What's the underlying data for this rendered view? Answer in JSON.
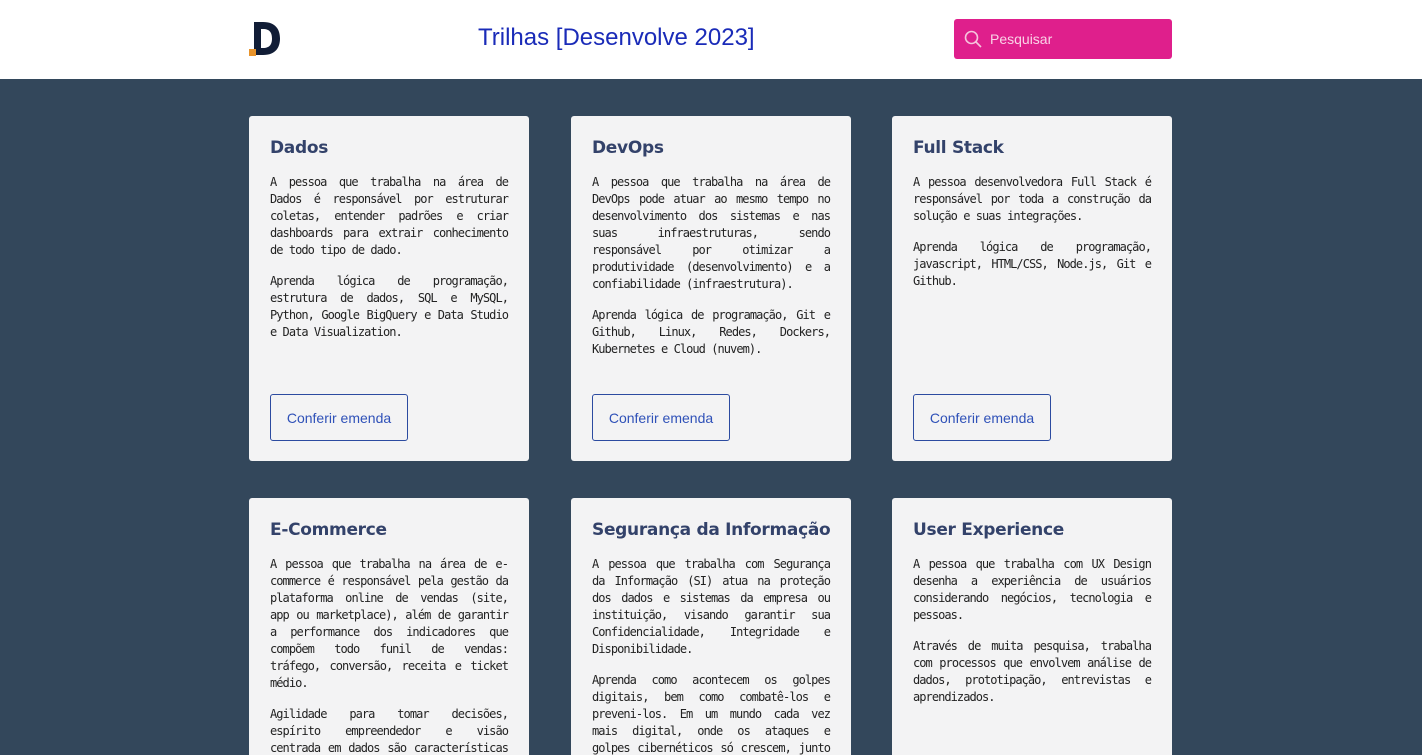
{
  "header": {
    "title": "Trilhas [Desenvolve 2023]",
    "logo_letter": "D",
    "search_placeholder": "Pesquisar"
  },
  "colors": {
    "background": "#33475b",
    "header": "#ffffff",
    "title": "#1a2bb8",
    "search": "#df1f8c",
    "card": "#f3f3f4",
    "card_title": "#33426a",
    "button": "#2c4ba0",
    "logo_accent": "#e8942c"
  },
  "cards": [
    {
      "title": "Dados",
      "paragraphs": [
        "A pessoa que trabalha na área de Dados é responsável por estruturar coletas, entender padrões e criar dashboards para extrair conhecimento de todo tipo de dado.",
        "Aprenda lógica de programação, estrutura de dados, SQL e MySQL, Python, Google BigQuery e Data Studio e Data Visualization."
      ],
      "button": "Conferir emenda"
    },
    {
      "title": "DevOps",
      "paragraphs": [
        "A pessoa que trabalha na área de DevOps pode atuar ao mesmo tempo no desenvolvimento dos sistemas e nas suas infraestruturas, sendo responsável por otimizar a produtividade (desenvolvimento) e a confiabilidade (infraestrutura).",
        "Aprenda lógica de programação, Git e Github, Linux, Redes, Dockers, Kubernetes e Cloud (nuvem)."
      ],
      "button": "Conferir emenda"
    },
    {
      "title": "Full Stack",
      "paragraphs": [
        "A pessoa desenvolvedora Full Stack é responsável por toda a construção da solução e suas integrações.",
        "Aprenda lógica de programação, javascript, HTML/CSS, Node.js, Git e Github."
      ],
      "button": "Conferir emenda"
    },
    {
      "title": "E-Commerce",
      "paragraphs": [
        "A pessoa que trabalha na área de e-commerce é responsável pela gestão da plataforma online de vendas (site, app ou marketplace), além de garantir a performance dos indicadores que compõem todo funil de vendas: tráfego, conversão, receita e ticket médio.",
        "Agilidade para tomar decisões, espírito empreendedor e visão centrada em dados são características presentes do profissional de e-commerce."
      ]
    },
    {
      "title": "Segurança da Informação",
      "paragraphs": [
        "A pessoa que trabalha com Segurança da Informação (SI) atua na proteção dos dados e sistemas da empresa ou instituição, visando garantir sua Confidencialidade, Integridade e Disponibilidade.",
        "Aprenda como acontecem os golpes digitais, bem como combatê-los e preveni-los. Em um mundo cada vez mais digital, onde os ataques e golpes cibernéticos só crescem, junto ao"
      ]
    },
    {
      "title": "User Experience",
      "paragraphs": [
        "A pessoa que trabalha com UX Design desenha a experiência de usuários considerando negócios, tecnologia e pessoas.",
        "Através de muita pesquisa, trabalha com processos que envolvem análise de dados, prototipação, entrevistas e aprendizados."
      ]
    }
  ]
}
